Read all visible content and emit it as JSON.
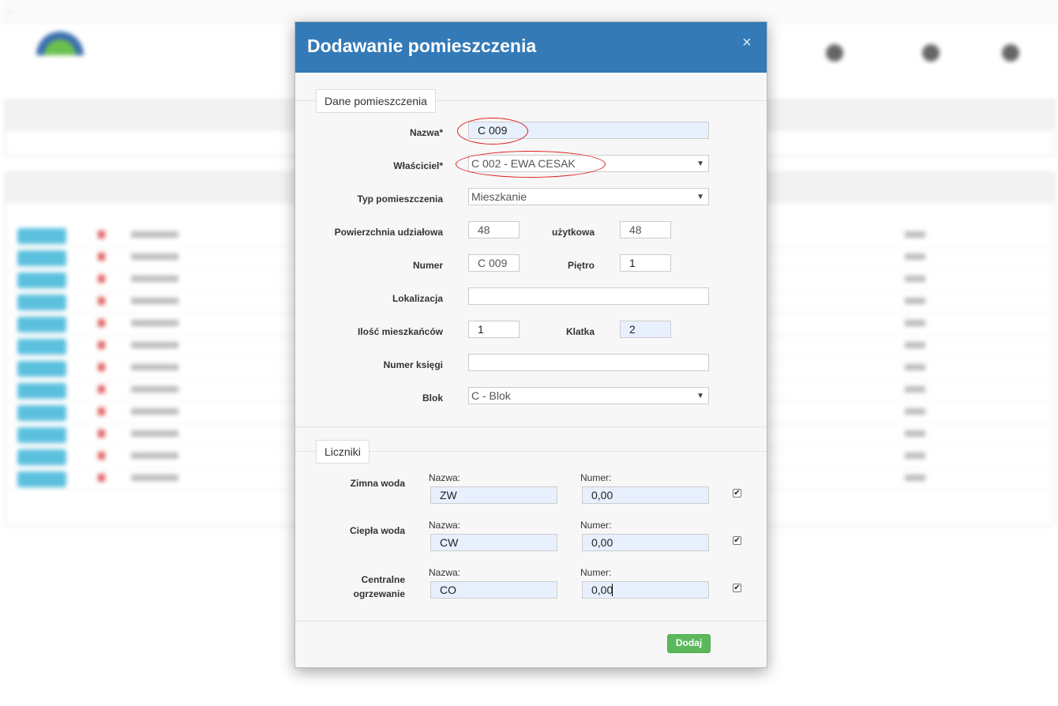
{
  "background": {
    "topbar": [
      "← ",
      "",
      "",
      "",
      "",
      ""
    ],
    "logo_sub": "",
    "nav": [
      "",
      "",
      ""
    ],
    "panel_filter_title": "",
    "panel_list_title": "",
    "row_count": 12
  },
  "modal": {
    "title": "Dodawanie pomieszczenia",
    "close_icon": "×",
    "section_room": {
      "legend": "Dane pomieszczenia",
      "name_label": "Nazwa*",
      "name_value": "C 009",
      "owner_label": "Właściciel*",
      "owner_value": "C 002 - EWA CESAK",
      "type_label": "Typ pomieszczenia",
      "type_value": "Mieszkanie",
      "share_area_label": "Powierzchnia udziałowa",
      "share_area_value": "48",
      "usable_label": "użytkowa",
      "usable_value": "48",
      "number_label": "Numer",
      "number_value": "C 009",
      "floor_label": "Piętro",
      "floor_value": "1",
      "location_label": "Lokalizacja",
      "location_value": "",
      "residents_label": "Ilość mieszkańców",
      "residents_value": "1",
      "staircase_label": "Klatka",
      "staircase_value": "2",
      "book_label": "Numer księgi",
      "book_value": "",
      "block_label": "Blok",
      "block_value": "C - Blok"
    },
    "section_meters": {
      "legend": "Liczniki",
      "col_name": "Nazwa:",
      "col_number": "Numer:",
      "meters": [
        {
          "label": "Zimna woda",
          "name": "ZW",
          "number": "0,00",
          "checked": true
        },
        {
          "label": "Ciepła woda",
          "name": "CW",
          "number": "0,00",
          "checked": true
        },
        {
          "label": "Centralne ogrzewanie",
          "name": "CO",
          "number": "0,00",
          "checked": true
        }
      ]
    },
    "submit_label": "Dodaj"
  },
  "colors": {
    "header": "#337ab7",
    "submit": "#5cb85c",
    "highlight_ring": "#e01c1c",
    "autofill": "#e8f0fe"
  }
}
